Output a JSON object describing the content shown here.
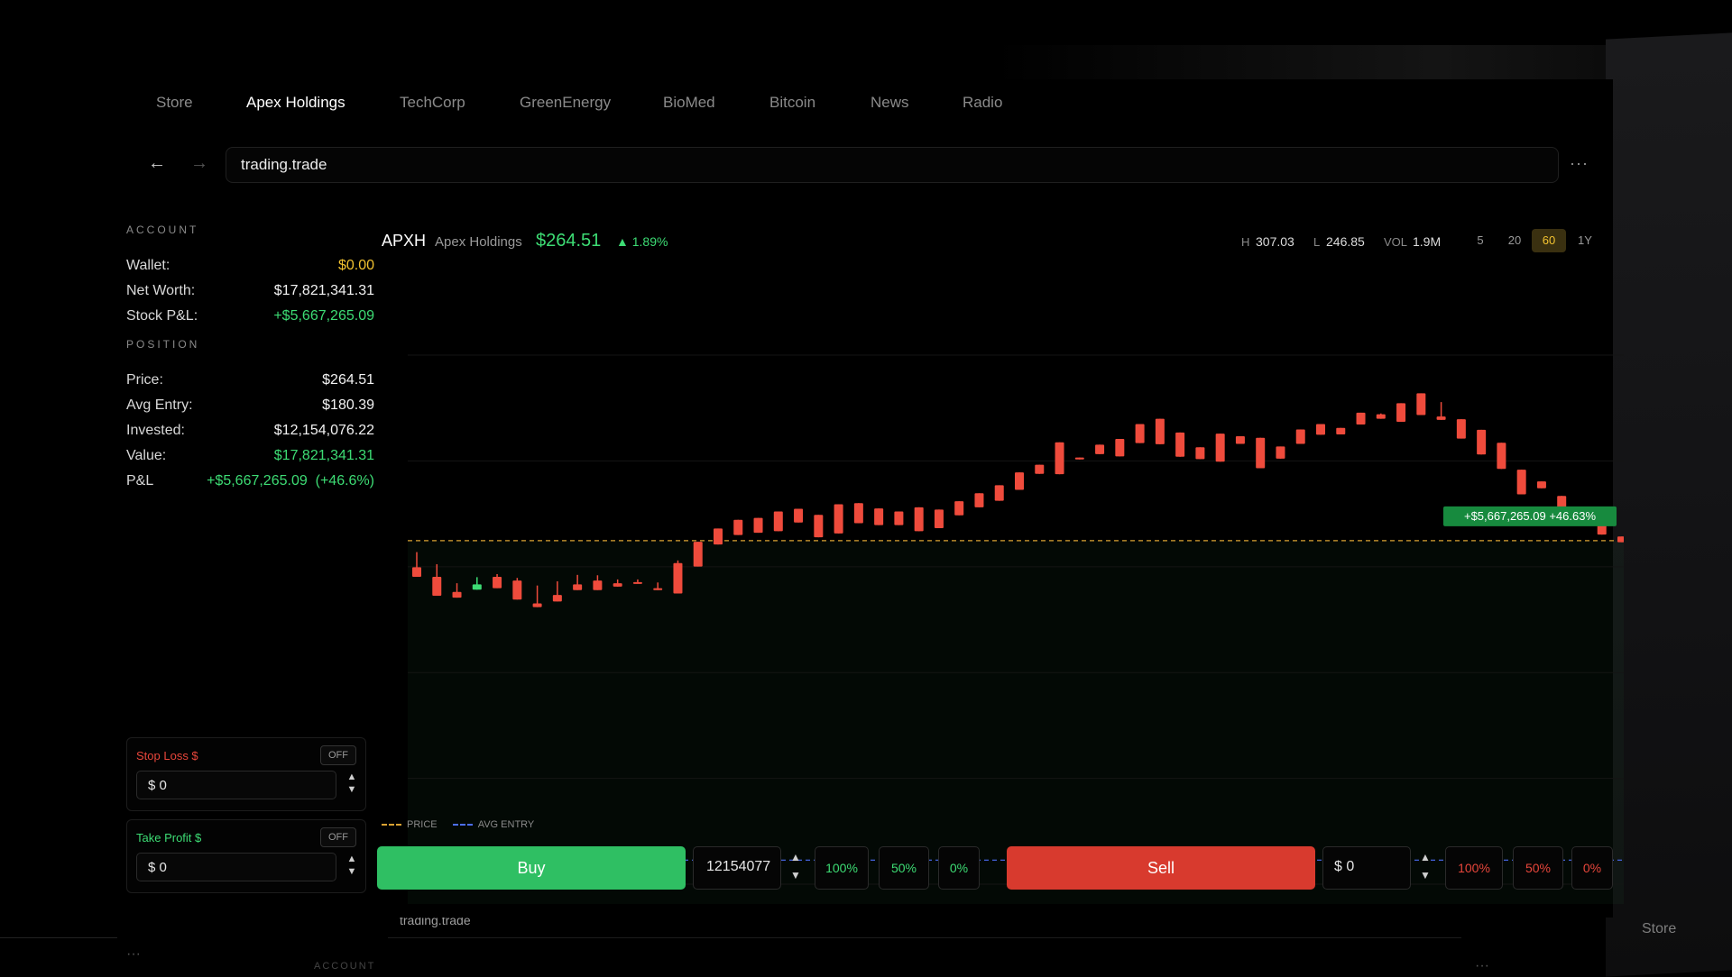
{
  "tabs": [
    "Store",
    "Apex Holdings",
    "TechCorp",
    "GreenEnergy",
    "BioMed",
    "Bitcoin",
    "News",
    "Radio"
  ],
  "active_tab": "Apex Holdings",
  "nav": {
    "back": "←",
    "forward": "→",
    "url": "trading.trade",
    "more": "···"
  },
  "account": {
    "label": "ACCOUNT",
    "wallet_label": "Wallet:",
    "wallet": "$0.00",
    "networth_label": "Net Worth:",
    "networth": "$17,821,341.31",
    "pnl_label": "Stock P&L:",
    "pnl": "+$5,667,265.09"
  },
  "position": {
    "label": "POSITION",
    "price_label": "Price:",
    "price": "$264.51",
    "avg_label": "Avg Entry:",
    "avg": "$180.39",
    "invested_label": "Invested:",
    "invested": "$12,154,076.22",
    "value_label": "Value:",
    "value": "$17,821,341.31",
    "pnl_label": "P&L",
    "pnl": "+$5,667,265.09  (+46.6%)"
  },
  "stop_loss": {
    "title": "Stop Loss $",
    "toggle": "OFF",
    "value": "$ 0"
  },
  "take_profit": {
    "title": "Take Profit $",
    "toggle": "OFF",
    "value": "$ 0"
  },
  "header": {
    "ticker": "APXH",
    "company": "Apex Holdings",
    "price": "$264.51",
    "change": "▲ 1.89%",
    "h_label": "H",
    "h_value": "307.03",
    "l_label": "L",
    "l_value": "246.85",
    "vol_label": "VOL",
    "vol_value": "1.9M",
    "ranges": [
      "5",
      "20",
      "60",
      "1Y"
    ],
    "active_range": "60"
  },
  "legend": {
    "price": "PRICE",
    "avg_entry": "AVG ENTRY"
  },
  "trade": {
    "buy_label": "Buy",
    "buy_qty": "12154077",
    "buy_pcts": [
      "100%",
      "50%",
      "0%"
    ],
    "sell_label": "Sell",
    "sell_amount": "$ 0",
    "sell_pcts": [
      "100%",
      "50%",
      "0%"
    ]
  },
  "background": {
    "url": "trading.trade",
    "account": "ACCOUNT",
    "store": "Store",
    "dots": "···"
  },
  "colors": {
    "up": "#3ddc74",
    "down": "#ef4b3c",
    "price_line": "#d9a132",
    "avg_line": "#4c6ef5",
    "price_tag": "#f2c230",
    "avg_tag": "#4c6ef5"
  },
  "chart_data": {
    "type": "candlestick",
    "y_ticks": [
      "313.37",
      "285.51",
      "257.64",
      "229.78",
      "201.92",
      "174.06"
    ],
    "ylim": [
      174.06,
      313.37
    ],
    "current_price": 264.51,
    "current_price_label": "264.51",
    "avg_entry": 180.39,
    "avg_entry_label": "180.39",
    "pnl_tag": "+$5,667,265.09 +46.63%",
    "candles": [
      [
        257.5,
        261.5,
        258.2,
        255
      ],
      [
        255,
        258.3,
        251.4,
        250
      ],
      [
        251,
        253.3,
        250.5,
        249.5
      ],
      [
        251.6,
        254.9,
        254.1,
        253
      ],
      [
        255,
        255.7,
        252.6,
        252
      ],
      [
        254,
        254.7,
        250.5,
        249
      ],
      [
        248,
        252.7,
        251.5,
        247
      ],
      [
        250.2,
        253.8,
        253.5,
        248.5
      ],
      [
        253,
        255.5,
        253.5,
        251.5
      ],
      [
        254,
        255.4,
        254.1,
        251.5
      ],
      [
        253.3,
        254.3,
        253.6,
        252.4
      ],
      [
        253.6,
        254.3,
        253.7,
        253.4
      ],
      [
        252,
        253.5,
        253.6,
        251.5
      ],
      [
        258.6,
        259.3,
        251.6,
        250.6
      ],
      [
        264.2,
        259.5,
        258.8,
        257.7
      ],
      [
        267.7,
        264.6,
        263.5,
        263.5
      ],
      [
        270,
        267.5,
        268,
        266
      ],
      [
        270.5,
        268.4,
        267.5,
        266.6
      ],
      [
        272.2,
        268.3,
        268.8,
        267
      ],
      [
        272.9,
        269.9,
        270.7,
        269.3
      ],
      [
        271.3,
        267.8,
        266.5,
        265.4
      ],
      [
        274.1,
        268.6,
        267.4,
        266.4
      ],
      [
        274.4,
        271.3,
        269.2,
        269.1
      ],
      [
        273,
        271.1,
        269.2,
        268.6
      ],
      [
        272.2,
        269.2,
        271,
        268.6
      ],
      [
        273.3,
        267.4,
        269.2,
        267
      ],
      [
        272.7,
        268.7,
        270,
        267.8
      ],
      [
        274.9,
        272.4,
        276.1,
        271.2
      ],
      [
        277,
        274.5,
        275.2,
        273.3
      ],
      [
        279.1,
        276.8,
        278.1,
        275
      ],
      [
        282.5,
        278.7,
        281,
        277.9
      ],
      [
        284.5,
        282.8,
        283.6,
        282.1
      ],
      [
        290.4,
        283.2,
        285.1,
        282
      ],
      [
        286.4,
        286.1,
        286.6,
        285.9
      ],
      [
        289.8,
        287.9,
        288,
        287.3
      ],
      [
        291.3,
        287.1,
        292.2,
        286.7
      ],
      [
        295.2,
        291.4,
        291.2,
        290.2
      ],
      [
        296.6,
        290.5,
        293.2,
        289.9
      ],
      [
        293,
        290.2,
        288.7,
        286.6
      ],
      [
        289.1,
        287.1,
        287.5,
        286
      ],
      [
        292.7,
        286.1,
        286.3,
        285.3
      ],
      [
        292,
        290.9,
        291.4,
        290
      ],
      [
        291.6,
        284.1,
        289.4,
        283.6
      ],
      [
        289.3,
        286.6,
        288.5,
        286.1
      ],
      [
        293.8,
        290.7,
        291.6,
        290
      ],
      [
        295.2,
        293,
        292.8,
        292.4
      ],
      [
        294.2,
        293,
        293.2,
        292.5
      ],
      [
        298.2,
        295.9,
        295.1,
        295.1
      ],
      [
        297.8,
        298,
        302.3,
        296.6
      ],
      [
        300.7,
        296.5,
        299.6,
        295.8
      ],
      [
        303.3,
        297.9,
        299.4,
        297.6
      ],
      [
        297.2,
        301,
        303.7,
        296.3
      ],
      [
        296.5,
        292.8,
        296.9,
        291.4
      ],
      [
        293.7,
        288.2,
        291.9,
        287.2
      ],
      [
        290.3,
        285.1,
        286.9,
        283.4
      ],
      [
        283.2,
        278.6,
        280.4,
        276.7
      ],
      [
        280.1,
        279.4,
        279.5,
        278.3
      ],
      [
        276.3,
        275.6,
        272.1,
        271.1
      ],
      [
        273.5,
        271.1,
        271.3,
        270.1
      ],
      [
        272.3,
        269.5,
        267.2,
        266.1
      ],
      [
        265.6,
        262.6,
        265.9,
        264.1
      ]
    ]
  }
}
